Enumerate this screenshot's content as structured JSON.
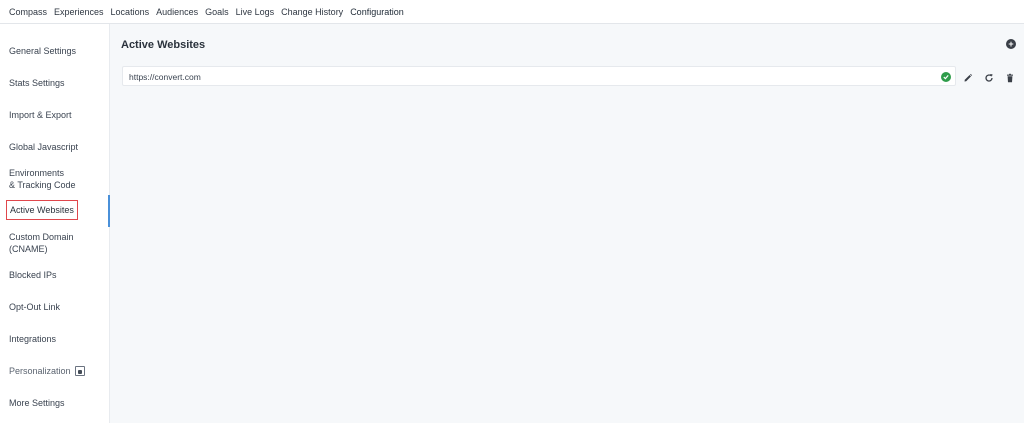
{
  "topnav": {
    "tabs": [
      {
        "label": "Compass"
      },
      {
        "label": "Experiences"
      },
      {
        "label": "Locations"
      },
      {
        "label": "Audiences"
      },
      {
        "label": "Goals"
      },
      {
        "label": "Live Logs"
      },
      {
        "label": "Change History"
      },
      {
        "label": "Configuration"
      }
    ],
    "active": "Configuration"
  },
  "sidebar": {
    "items": [
      {
        "label": "General Settings"
      },
      {
        "label": "Stats Settings"
      },
      {
        "label": "Import & Export"
      },
      {
        "label": "Global Javascript"
      },
      {
        "label_line1": "Environments",
        "label_line2": "& Tracking Code"
      },
      {
        "label": "Active Websites"
      },
      {
        "label_line1": "Custom Domain",
        "label_line2": "(CNAME)"
      },
      {
        "label": "Blocked IPs"
      },
      {
        "label": "Opt-Out Link"
      },
      {
        "label": "Integrations"
      },
      {
        "label": "Personalization",
        "icon": "lock-icon"
      },
      {
        "label": "More Settings"
      }
    ],
    "active": "Active Websites"
  },
  "main": {
    "title": "Active Websites",
    "add_icon": "plus-circle-icon",
    "websites": [
      {
        "url": "https://convert.com",
        "status": "verified"
      }
    ]
  },
  "colors": {
    "accent": "#4a90d9",
    "highlight_border": "#e0474c",
    "success": "#2e9c4a",
    "content_bg": "#f6f8fa"
  }
}
